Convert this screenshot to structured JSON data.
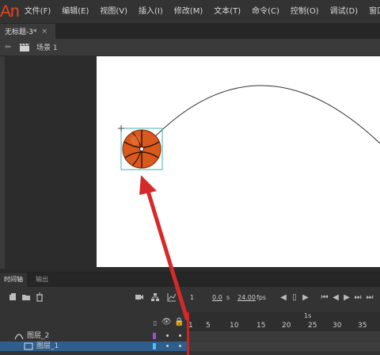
{
  "app": {
    "logo": "An",
    "logo_color": "#e8441f"
  },
  "menu": [
    "文件(F)",
    "编辑(E)",
    "视图(V)",
    "插入(I)",
    "修改(M)",
    "文本(T)",
    "命令(C)",
    "控制(O)",
    "调试(D)",
    "窗口"
  ],
  "document": {
    "tab_title": "无标题-3*",
    "close_glyph": "×"
  },
  "editbar": {
    "scene_label": "场景 1"
  },
  "timeline": {
    "tabs": [
      "时间轴",
      "输出"
    ],
    "current_frame": "1",
    "elapsed_time": "0.0",
    "time_unit": "s",
    "fps_value": "24.00",
    "fps_unit": "fps",
    "second_marker": "1s",
    "ruler_numbers": [
      "1",
      "5",
      "10",
      "15",
      "20",
      "25",
      "30",
      "35"
    ],
    "layers": [
      {
        "name": "图层_2",
        "selected": false,
        "color": "#9b4fd8"
      },
      {
        "name": "图层_1",
        "selected": true,
        "color": "#40c8f0"
      }
    ]
  },
  "colors": {
    "accent_red": "#d62a2a",
    "selection_blue": "#2f5d8c",
    "bounding_box": "#3fb3b8",
    "ball": "#d95a1e"
  },
  "icons": {
    "timeline_left": [
      "new-layer-icon",
      "new-folder-icon",
      "delete-icon"
    ],
    "timeline_mid": [
      "camera-icon",
      "hierarchy-icon",
      "graph-icon"
    ],
    "transport": [
      "step-back-icon",
      "frame-marker-icon",
      "step-forward-icon",
      "go-first-icon",
      "prev-frame-icon",
      "play-icon",
      "next-frame-icon",
      "go-last-icon"
    ],
    "layer_header": [
      "eye-icon",
      "lock-icon",
      "outline-icon"
    ]
  }
}
